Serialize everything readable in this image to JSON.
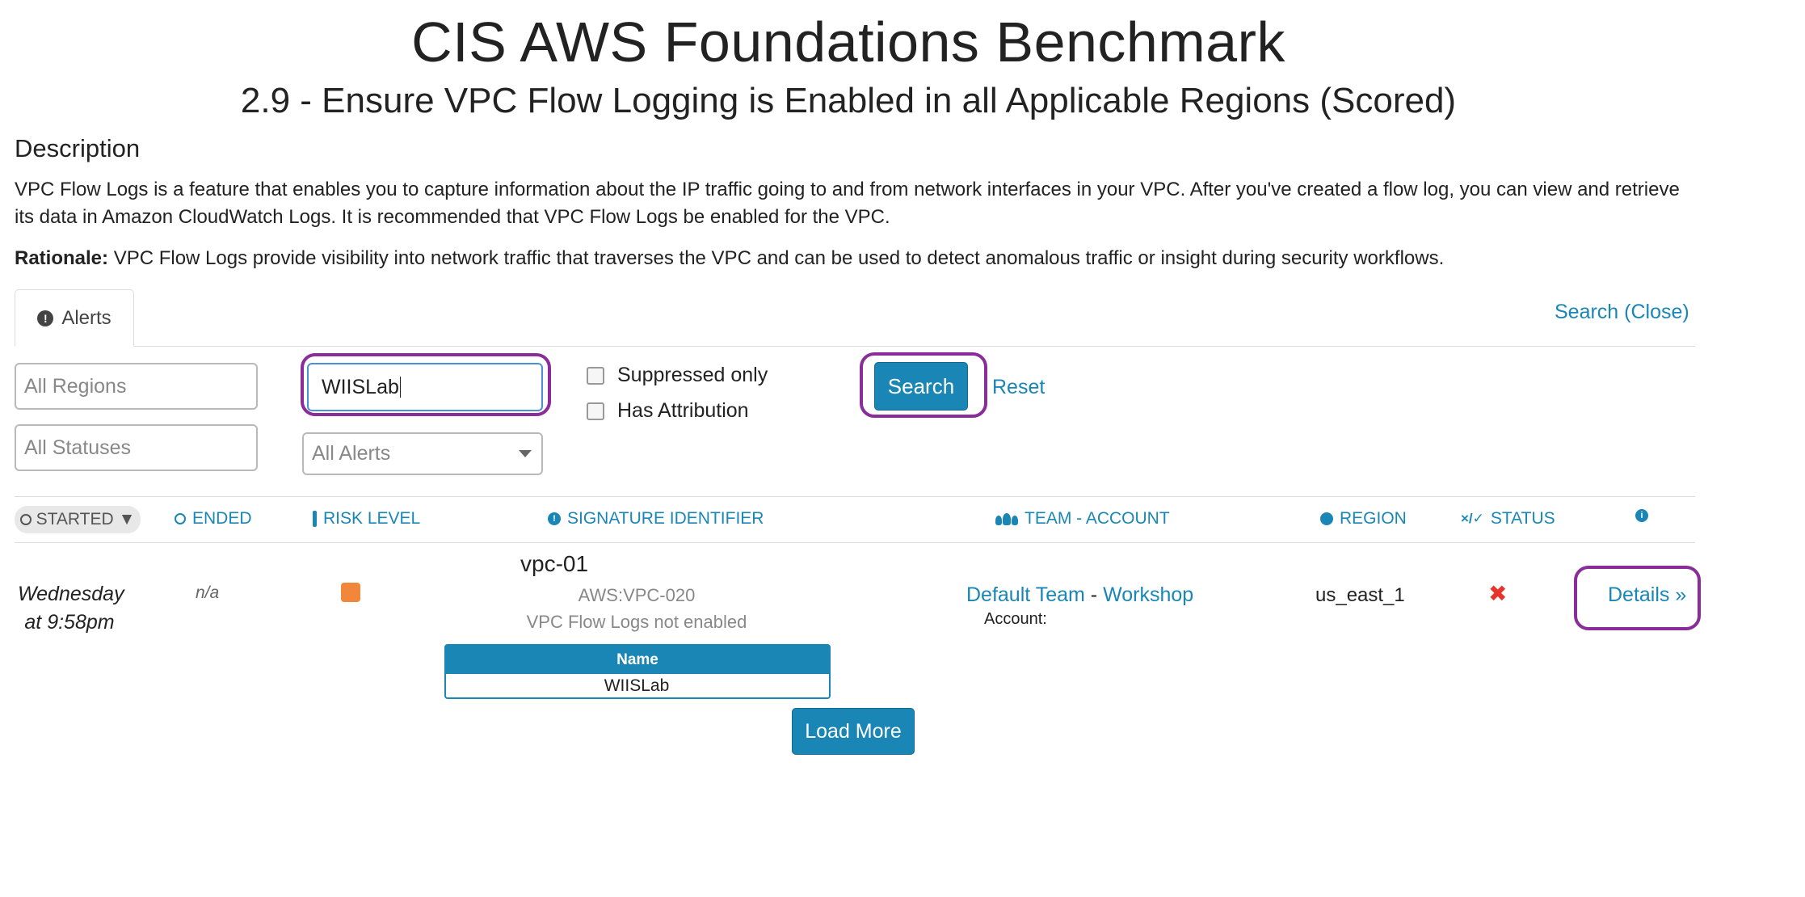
{
  "header": {
    "title": "CIS AWS Foundations Benchmark",
    "subtitle": "2.9 - Ensure VPC Flow Logging is Enabled in all Applicable Regions (Scored)"
  },
  "description": {
    "heading": "Description",
    "text": "VPC Flow Logs is a feature that enables you to capture information about the IP traffic going to and from network interfaces in your VPC. After you've created a flow log, you can view and retrieve its data in Amazon CloudWatch Logs. It is recommended that VPC Flow Logs be enabled for the VPC.",
    "rationale_label": "Rationale:",
    "rationale_text": "VPC Flow Logs provide visibility into network traffic that traverses the VPC and can be used to detect anomalous traffic or insight during security workflows."
  },
  "tabs": {
    "alerts_label": "Alerts",
    "search_close": "Search (Close)"
  },
  "filters": {
    "regions_placeholder": "All Regions",
    "statuses_placeholder": "All Statuses",
    "search_value": "WIISLab",
    "alerts_select": "All Alerts",
    "suppressed_label": "Suppressed only",
    "attribution_label": "Has Attribution",
    "search_button": "Search",
    "reset_link": "Reset"
  },
  "table": {
    "headers": {
      "started": "STARTED",
      "ended": "ENDED",
      "risk": "RISK LEVEL",
      "signature": "SIGNATURE IDENTIFIER",
      "team": "TEAM - ACCOUNT",
      "region": "REGION",
      "status": "STATUS"
    },
    "row": {
      "started_line1": "Wednesday",
      "started_line2": "at 9:58pm",
      "ended": "n/a",
      "risk_color": "#f0873a",
      "sig_name": "vpc-01",
      "sig_id": "AWS:VPC-020",
      "sig_desc": "VPC Flow Logs not enabled",
      "name_header": "Name",
      "name_value": "WIISLab",
      "team": "Default Team",
      "team_sep": "-",
      "workshop": "Workshop",
      "account_label": "Account:",
      "region": "us_east_1",
      "status_icon": "✖",
      "details": "Details »"
    }
  },
  "load_more": "Load More",
  "colors": {
    "accent": "#1a86b5",
    "highlight": "#8a2d9a",
    "danger": "#e8352b"
  }
}
